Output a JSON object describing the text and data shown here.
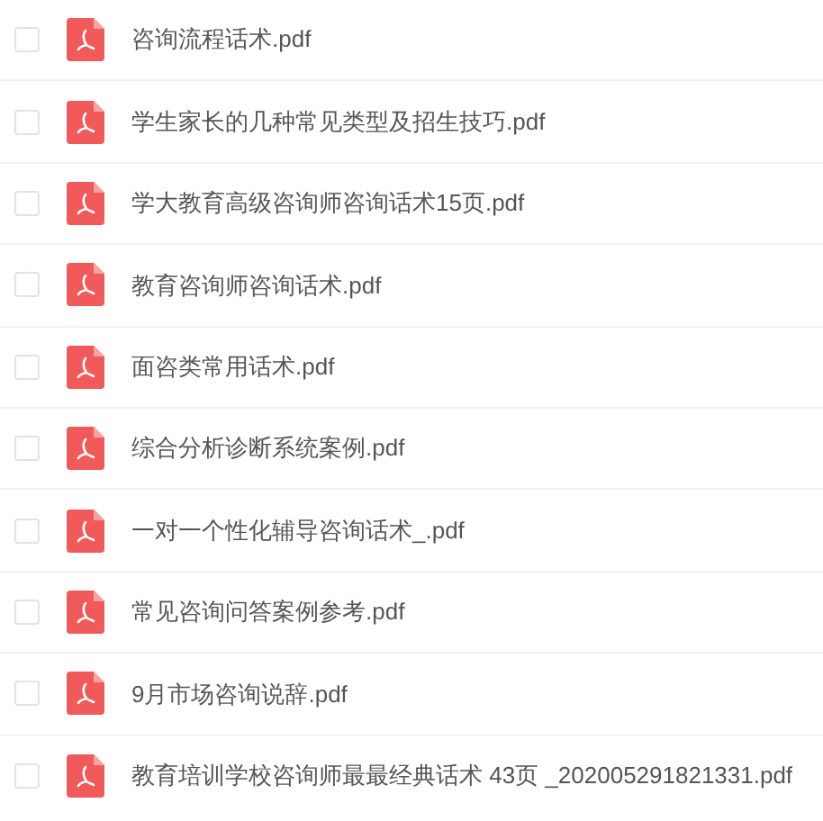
{
  "files": [
    {
      "name": "咨询流程话术.pdf",
      "checked": false
    },
    {
      "name": "学生家长的几种常见类型及招生技巧.pdf",
      "checked": false
    },
    {
      "name": "学大教育高级咨询师咨询话术15页.pdf",
      "checked": false
    },
    {
      "name": "教育咨询师咨询话术.pdf",
      "checked": false
    },
    {
      "name": "面咨类常用话术.pdf",
      "checked": false
    },
    {
      "name": "综合分析诊断系统案例.pdf",
      "checked": false
    },
    {
      "name": "一对一个性化辅导咨询话术_.pdf",
      "checked": false
    },
    {
      "name": "常见咨询问答案例参考.pdf",
      "checked": false
    },
    {
      "name": "9月市场咨询说辞.pdf",
      "checked": false
    },
    {
      "name": "教育培训学校咨询师最最经典话术 43页 _202005291821331.pdf",
      "checked": false
    }
  ]
}
